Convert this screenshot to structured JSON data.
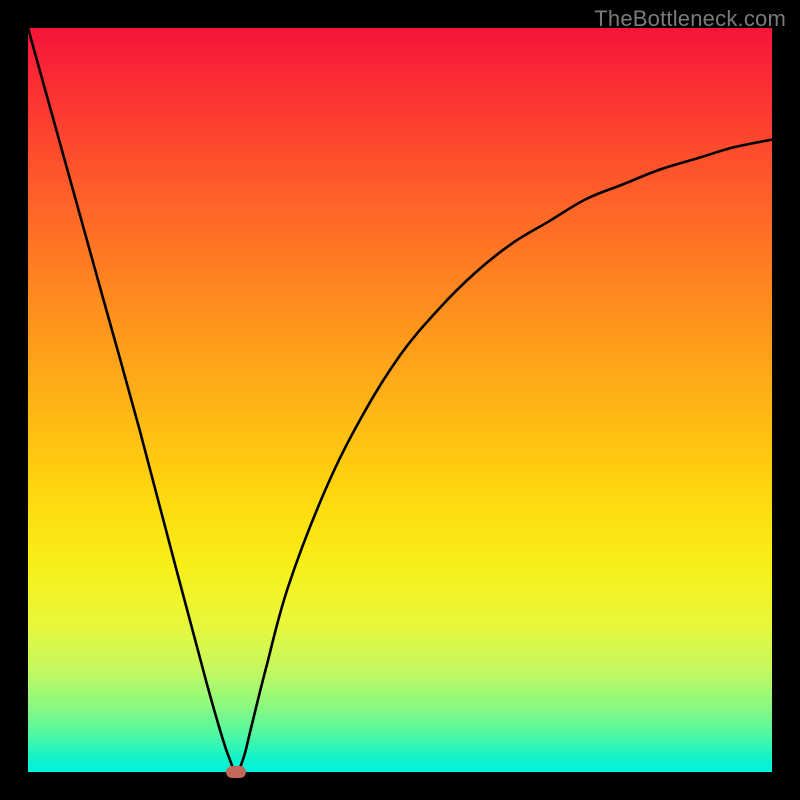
{
  "watermark": "TheBottleneck.com",
  "chart_data": {
    "type": "line",
    "title": "",
    "xlabel": "",
    "ylabel": "",
    "xlim": [
      0,
      100
    ],
    "ylim": [
      0,
      100
    ],
    "grid": false,
    "legend": false,
    "series": [
      {
        "name": "curve",
        "x": [
          0,
          5,
          10,
          15,
          20,
          24,
          26,
          27,
          28,
          29,
          30,
          32,
          35,
          40,
          45,
          50,
          55,
          60,
          65,
          70,
          75,
          80,
          85,
          90,
          95,
          100
        ],
        "y": [
          100,
          82,
          64,
          46,
          27,
          12,
          5,
          2,
          0,
          2,
          6,
          14,
          25,
          38,
          48,
          56,
          62,
          67,
          71,
          74,
          77,
          79,
          81,
          82.5,
          84,
          85
        ]
      }
    ],
    "marker": {
      "x": 28,
      "y": 0,
      "color": "#c1675b"
    },
    "background_gradient": [
      "#f6143a",
      "#ffd60e",
      "#00f2e0"
    ]
  }
}
